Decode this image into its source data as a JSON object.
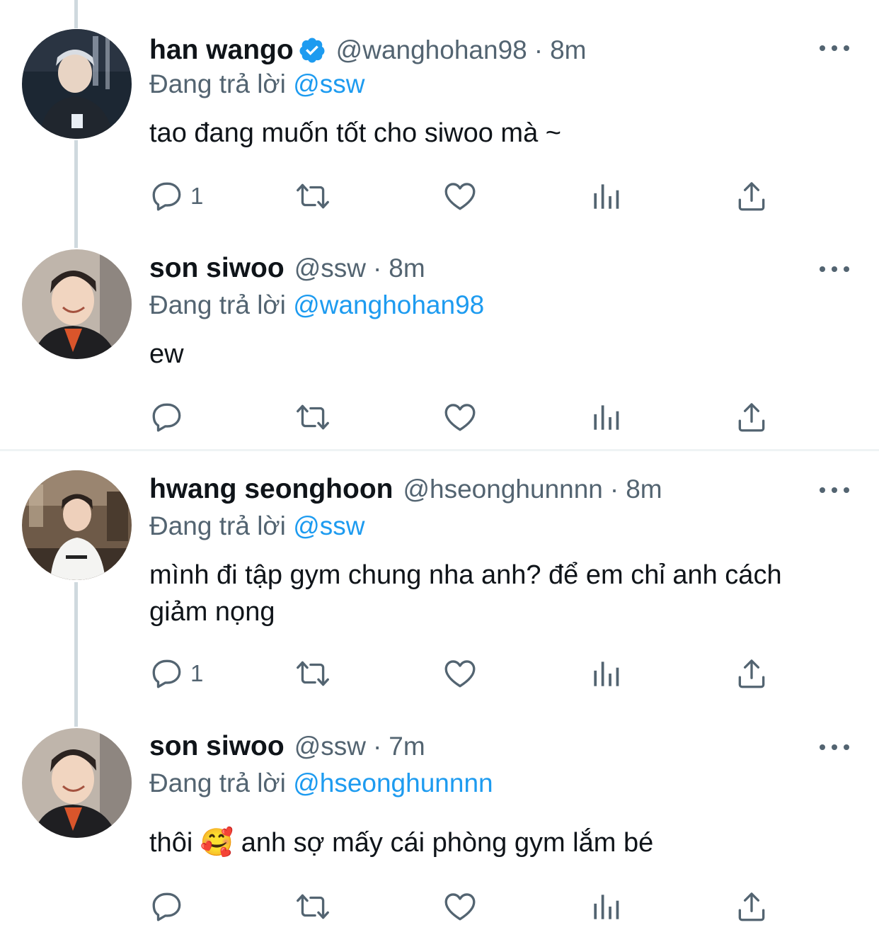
{
  "tweets": [
    {
      "display_name": "han wango",
      "verified": true,
      "handle": "@wanghohan98",
      "separator": "·",
      "time": "8m",
      "replying_prefix": "Đang trả lời",
      "replying_to": "@ssw",
      "text": "tao đang muốn tốt cho siwoo mà ~",
      "reply_count": "1"
    },
    {
      "display_name": "son siwoo",
      "verified": false,
      "handle": "@ssw",
      "separator": "·",
      "time": "8m",
      "replying_prefix": "Đang trả lời",
      "replying_to": "@wanghohan98",
      "text": "ew",
      "reply_count": ""
    },
    {
      "display_name": "hwang seonghoon",
      "verified": false,
      "handle": "@hseonghunnnn",
      "separator": "·",
      "time": "8m",
      "replying_prefix": "Đang trả lời",
      "replying_to": "@ssw",
      "text": "mình đi tập gym chung nha anh? để em chỉ anh cách giảm nọng",
      "reply_count": "1"
    },
    {
      "display_name": "son siwoo",
      "verified": false,
      "handle": "@ssw",
      "separator": "·",
      "time": "7m",
      "replying_prefix": "Đang trả lời",
      "replying_to": "@hseonghunnnn",
      "text": "thôi 🥰  anh sợ mấy cái phòng gym lắm bé",
      "reply_count": ""
    }
  ],
  "icons": {
    "reply": "reply-icon",
    "retweet": "retweet-icon",
    "like": "heart-icon",
    "views": "views-icon",
    "share": "share-icon",
    "more": "more-icon",
    "verified": "verified-badge-icon"
  },
  "colors": {
    "text": "#0f1419",
    "secondary": "#536471",
    "accent": "#1d9bf0",
    "thread_line": "#cfd9de",
    "divider": "#eff3f4"
  }
}
